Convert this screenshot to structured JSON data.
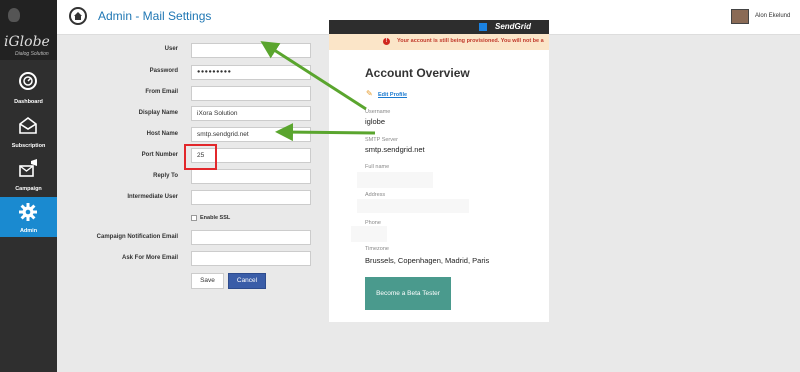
{
  "app": {
    "brand": "iGlobe",
    "tagline": "Dialog Solution"
  },
  "sidebar": {
    "items": [
      {
        "label": "Dashboard",
        "icon": "gauge-icon"
      },
      {
        "label": "Subscription",
        "icon": "envelope-open-icon"
      },
      {
        "label": "Campaign",
        "icon": "megaphone-envelope-icon"
      },
      {
        "label": "Admin",
        "icon": "gear-icon",
        "active": true
      }
    ]
  },
  "header": {
    "title": "Admin - Mail Settings",
    "user_name": "Alon Ekelund"
  },
  "form": {
    "fields": [
      {
        "label": "User",
        "value": ""
      },
      {
        "label": "Password",
        "value": "●●●●●●●●●"
      },
      {
        "label": "From Email",
        "value": ""
      },
      {
        "label": "Display Name",
        "value": "iXora Solution"
      },
      {
        "label": "Host Name",
        "value": "smtp.sendgrid.net"
      },
      {
        "label": "Port Number",
        "value": "25"
      },
      {
        "label": "Reply To",
        "value": ""
      },
      {
        "label": "Intermediate User",
        "value": ""
      },
      {
        "label": "Campaign Notification Email",
        "value": ""
      },
      {
        "label": "Ask For More Email",
        "value": ""
      }
    ],
    "ssl_label": "Enable SSL",
    "save_label": "Save",
    "cancel_label": "Cancel"
  },
  "sendgrid": {
    "logo": "SendGrid",
    "alert": "Your account is still being provisioned. You will not be a",
    "heading": "Account Overview",
    "edit_profile": "Edit Profile",
    "username_label": "Username",
    "username_value": "iglobe",
    "smtp_label": "SMTP Server",
    "smtp_value": "smtp.sendgrid.net",
    "fullname_label": "Full name",
    "address_label": "Address",
    "phone_label": "Phone",
    "timezone_label": "Timezone",
    "timezone_value": "Brussels, Copenhagen, Madrid, Paris",
    "beta_button": "Become a Beta Tester"
  },
  "colors": {
    "accent": "#1a8ad0",
    "highlight": "#e2272b",
    "arrow": "#5aa52e",
    "beta": "#4a9a8d"
  }
}
